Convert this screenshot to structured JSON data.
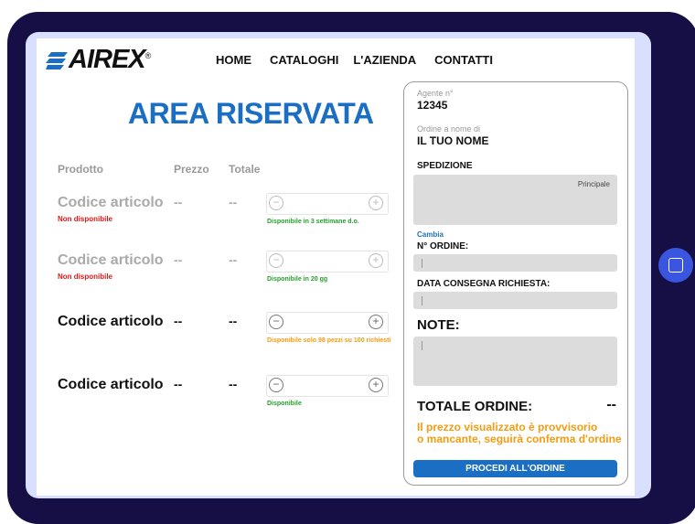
{
  "brand": {
    "logo_text": "AIREX",
    "registered_mark": "®",
    "logo_color": "#1a6fc4"
  },
  "nav": {
    "items": [
      "HOME",
      "CATALOGHI",
      "L'AZIENDA",
      "CONTATTI"
    ]
  },
  "page_title": "AREA RISERVATA",
  "table_headers": {
    "product": "Prodotto",
    "price": "Prezzo",
    "total": "Totale"
  },
  "products": [
    {
      "name": "Codice articolo",
      "availability": "Non disponibile",
      "price": "--",
      "total": "--",
      "stock_note": "Disponibile in 3 settimane d.o."
    },
    {
      "name": "Codice articolo",
      "availability": "Non disponibile",
      "price": "--",
      "total": "--",
      "stock_note": "Disponibile in 20 gg"
    },
    {
      "name": "Codice articolo",
      "availability": "",
      "price": "--",
      "total": "--",
      "stock_note": "Disponibile solo 98 pezzi su 100 richiesti"
    },
    {
      "name": "Codice articolo",
      "availability": "",
      "price": "--",
      "total": "--",
      "stock_note": "Disponibile"
    }
  ],
  "stepper": {
    "minus": "−",
    "plus": "+"
  },
  "order_panel": {
    "agent_label": "Agente n°",
    "agent_number": "12345",
    "name_label": "Ordine a nome di",
    "name_value": "IL TUO NOME",
    "shipping_title": "SPEDIZIONE",
    "shipping_tag": "Principale",
    "change_link": "Cambia",
    "order_number_label": "N° ORDINE:",
    "delivery_date_label": "DATA CONSEGNA RICHIESTA:",
    "notes_label": "NOTE:",
    "total_label": "TOTALE ORDINE:",
    "total_value": "--",
    "disclaimer_line1": "Il prezzo visualizzato è provvisorio",
    "disclaimer_line2": "o mancante, seguirà conferma d'ordine",
    "proceed_button": "PROCEDI ALL'ORDINE"
  },
  "colors": {
    "accent_blue": "#1a6fc4",
    "unavailable_red": "#e01818",
    "available_green": "#25a02c",
    "warning_orange": "#f39c12",
    "tablet_frame": "#150f45"
  }
}
